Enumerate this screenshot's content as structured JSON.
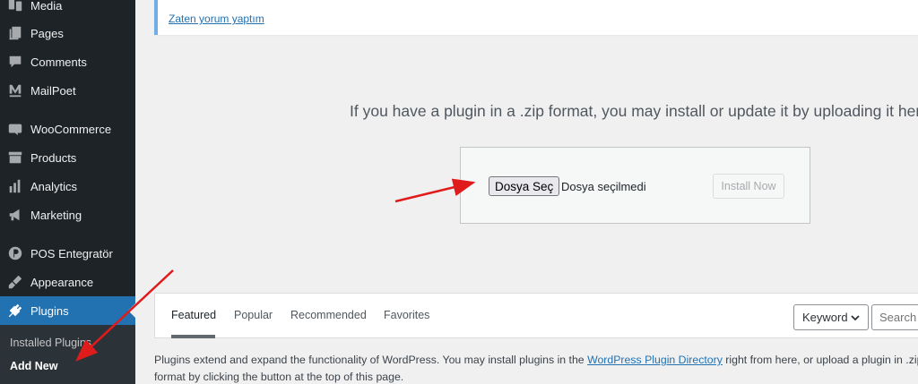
{
  "sidebar": {
    "items": [
      {
        "label": "Media",
        "icon": "media-icon"
      },
      {
        "label": "Pages",
        "icon": "pages-icon"
      },
      {
        "label": "Comments",
        "icon": "comments-icon"
      },
      {
        "label": "MailPoet",
        "icon": "mailpoet-icon"
      },
      {
        "label": "WooCommerce",
        "icon": "woocommerce-icon"
      },
      {
        "label": "Products",
        "icon": "products-icon"
      },
      {
        "label": "Analytics",
        "icon": "analytics-icon"
      },
      {
        "label": "Marketing",
        "icon": "marketing-icon"
      },
      {
        "label": "POS Entegratör",
        "icon": "pos-icon"
      },
      {
        "label": "Appearance",
        "icon": "appearance-icon"
      },
      {
        "label": "Plugins",
        "icon": "plugins-icon"
      }
    ],
    "submenu": {
      "installed": "Installed Plugins",
      "add_new": "Add New"
    }
  },
  "notice": {
    "link": "Zaten yorum yaptım"
  },
  "upload": {
    "description": "If you have a plugin in a .zip format, you may install or update it by uploading it here.",
    "choose_file": "Dosya Seç",
    "no_file": "Dosya seçilmedi",
    "install_button": "Install Now"
  },
  "filter": {
    "tabs": [
      "Featured",
      "Popular",
      "Recommended",
      "Favorites"
    ],
    "search_type": "Keyword",
    "search_placeholder": "Search plugins..."
  },
  "footer_text": {
    "before": "Plugins extend and expand the functionality of WordPress. You may install plugins in the ",
    "link": "WordPress Plugin Directory",
    "after": " right from here, or upload a plugin in .zip format by clicking the button at the top of this page."
  },
  "colors": {
    "sidebar_bg": "#1d2327",
    "active_bg": "#2271b1",
    "link": "#2271b1",
    "arrow": "#e01b1b"
  }
}
